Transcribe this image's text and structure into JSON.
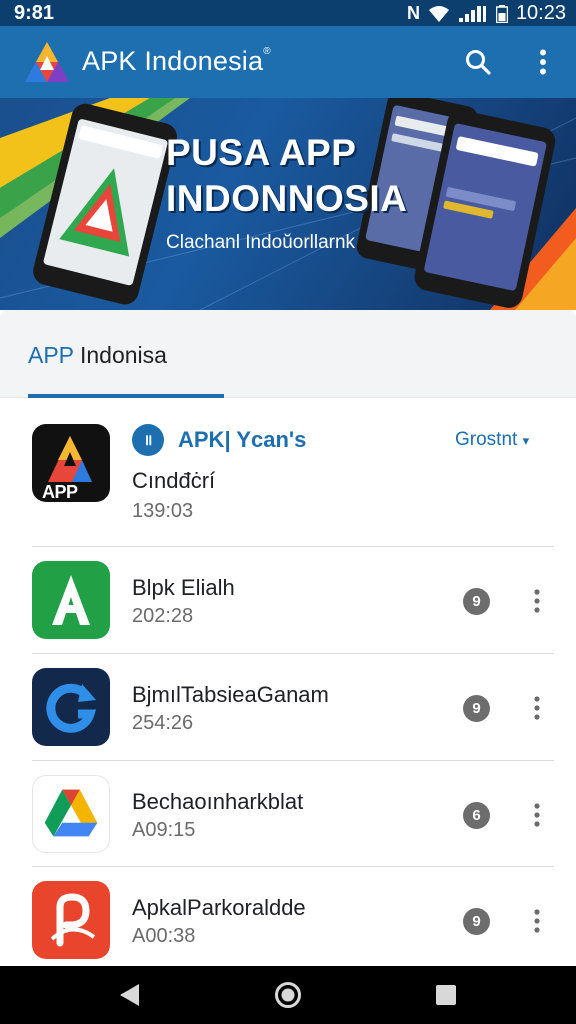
{
  "status_bar": {
    "time_left": "9:81",
    "network_letter": "N",
    "time_right": "10:23"
  },
  "app_bar": {
    "title": "APK Indonesia",
    "title_mark": "®"
  },
  "banner": {
    "title_line1": "PUSA APP",
    "title_line2": "INDONNOSIA",
    "subtitle": "Clachanl Indoŭorllarnk"
  },
  "section": {
    "tab_accent": "APP",
    "tab_rest": " Indonisa"
  },
  "featured": {
    "pill": "॥",
    "label": "APK| Ycan's",
    "action": "Grostnt",
    "action_chevron": "▾",
    "icon_text": "APP",
    "name": "Cındđċrí",
    "meta": "139:03"
  },
  "apps": [
    {
      "name": "Blpk Elialh",
      "meta": "202:28",
      "badge": "9",
      "icon": "letter-a-icon",
      "color": "#22a046"
    },
    {
      "name": "BjmılTabsieaGanam",
      "meta": "254:26",
      "badge": "9",
      "icon": "refresh-arrow-icon",
      "color": "#13294b"
    },
    {
      "name": "Bechaoınharkblat",
      "meta": "A09:15",
      "badge": "6",
      "icon": "drive-triangle-icon",
      "color": "#ffffff"
    },
    {
      "name": "ApkalParkoraldde",
      "meta": "A00:38",
      "badge": "9",
      "icon": "pdf-curl-icon",
      "color": "#e9452d"
    }
  ],
  "colors": {
    "primary": "#1e6fb0",
    "status_bar": "#0d3f6e",
    "nav_bar": "#000000"
  }
}
